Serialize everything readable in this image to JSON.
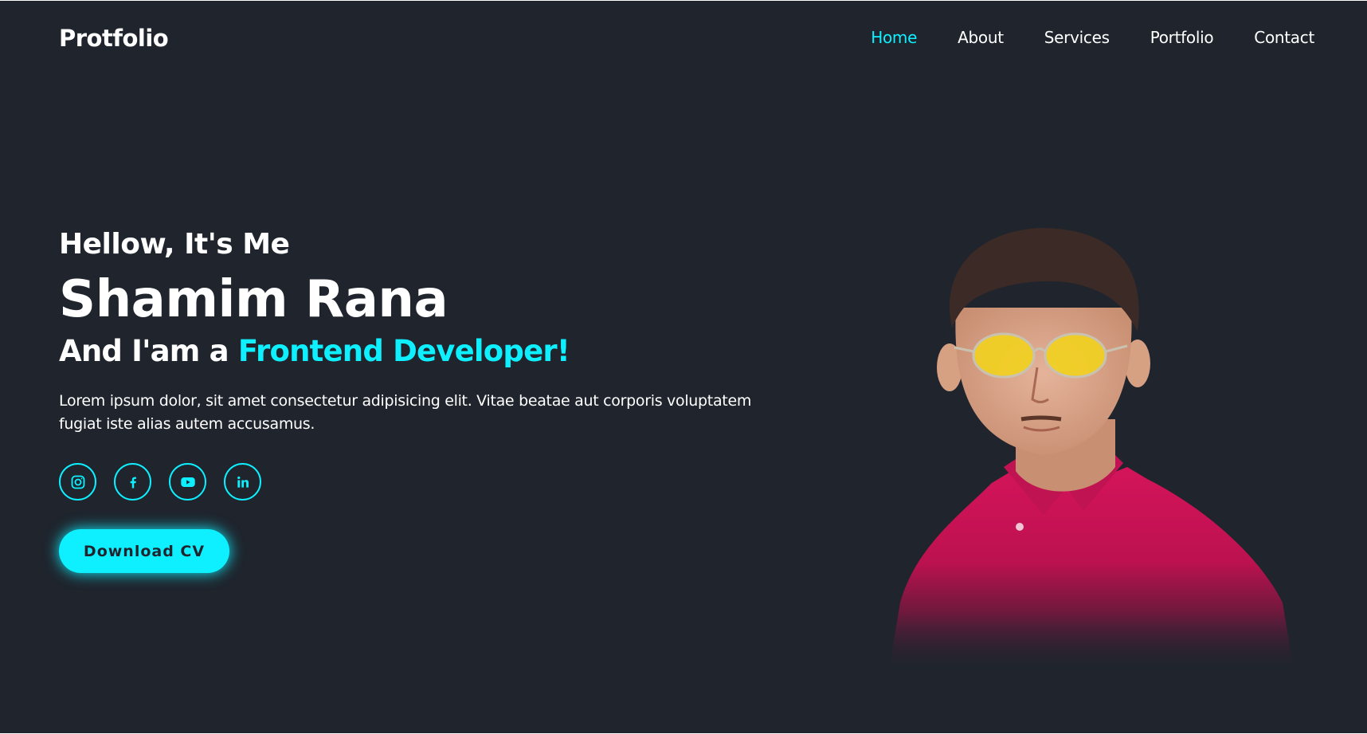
{
  "header": {
    "logo": "Protfolio",
    "nav": [
      {
        "label": "Home",
        "active": true
      },
      {
        "label": "About",
        "active": false
      },
      {
        "label": "Services",
        "active": false
      },
      {
        "label": "Portfolio",
        "active": false
      },
      {
        "label": "Contact",
        "active": false
      }
    ]
  },
  "hero": {
    "greeting": "Hellow, It's Me",
    "name": "Shamim Rana",
    "role_prefix": "And I'am a ",
    "role_highlight": "Frontend Developer!",
    "description": "Lorem ipsum dolor, sit amet consectetur adipisicing elit. Vitae beatae aut corporis voluptatem fugiat iste alias autem accusamus.",
    "socials": [
      {
        "icon": "instagram-icon"
      },
      {
        "icon": "facebook-icon"
      },
      {
        "icon": "youtube-icon"
      },
      {
        "icon": "linkedin-icon"
      }
    ],
    "button_label": "Download CV"
  },
  "colors": {
    "background": "#1f242d",
    "accent": "#0ef0ff",
    "text": "#ffffff"
  }
}
